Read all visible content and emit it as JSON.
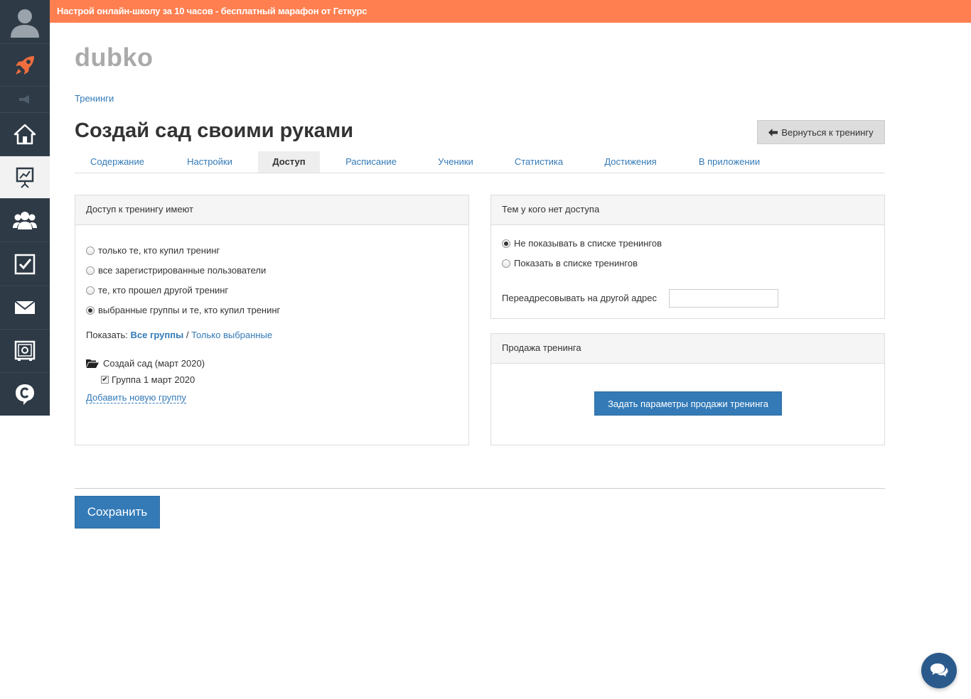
{
  "banner": {
    "text": "Настрой онлайн-школу за 10 часов - бесплатный марафон от Геткурс"
  },
  "sidebar": {
    "items": [
      {
        "icon": "user-avatar-icon"
      },
      {
        "icon": "rocket-icon"
      },
      {
        "icon": "megaphone-icon"
      },
      {
        "icon": "home-icon"
      },
      {
        "icon": "training-chart-icon",
        "active": true
      },
      {
        "icon": "users-group-icon"
      },
      {
        "icon": "checkbox-tasks-icon"
      },
      {
        "icon": "mail-icon"
      },
      {
        "icon": "safe-icon"
      },
      {
        "icon": "chat-logo-icon"
      }
    ]
  },
  "school_name": "dubko",
  "breadcrumb": "Тренинги",
  "page_title": "Создай сад своими руками",
  "back_button": "Вернуться к тренингу",
  "tabs": [
    {
      "label": "Содержание"
    },
    {
      "label": "Настройки"
    },
    {
      "label": "Доступ",
      "active": true
    },
    {
      "label": "Расписание"
    },
    {
      "label": "Ученики"
    },
    {
      "label": "Статистика"
    },
    {
      "label": "Достижения"
    },
    {
      "label": "В приложении"
    }
  ],
  "access_panel": {
    "title": "Доступ к тренингу имеют",
    "options": [
      {
        "label": "только те, кто купил тренинг",
        "checked": false
      },
      {
        "label": "все зарегистрированные пользователи",
        "checked": false
      },
      {
        "label": "те, кто прошел другой тренинг",
        "checked": false
      },
      {
        "label": "выбранные группы и те, кто купил тренинг",
        "checked": true
      }
    ],
    "show_label": "Показать:",
    "show_all": "Все группы",
    "show_sep": "/",
    "show_selected": "Только выбранные",
    "folder_name": "Создай сад (март 2020)",
    "group_name": "Группа 1 март 2020",
    "group_checked": true,
    "add_group": "Добавить новую группу"
  },
  "no_access_panel": {
    "title": "Тем у кого нет доступа",
    "options": [
      {
        "label": "Не показывать в списке тренингов",
        "checked": true
      },
      {
        "label": "Показать в списке тренингов",
        "checked": false
      }
    ],
    "redirect_label": "Переадресовывать на другой адрес",
    "redirect_value": ""
  },
  "sale_panel": {
    "title": "Продажа тренинга",
    "button": "Задать параметры продажи тренинга"
  },
  "save_button": "Сохранить",
  "colors": {
    "banner": "#ff7f50",
    "sidebar": "#2e3a46",
    "primary": "#337ab7",
    "rocket": "#f26d3d"
  }
}
